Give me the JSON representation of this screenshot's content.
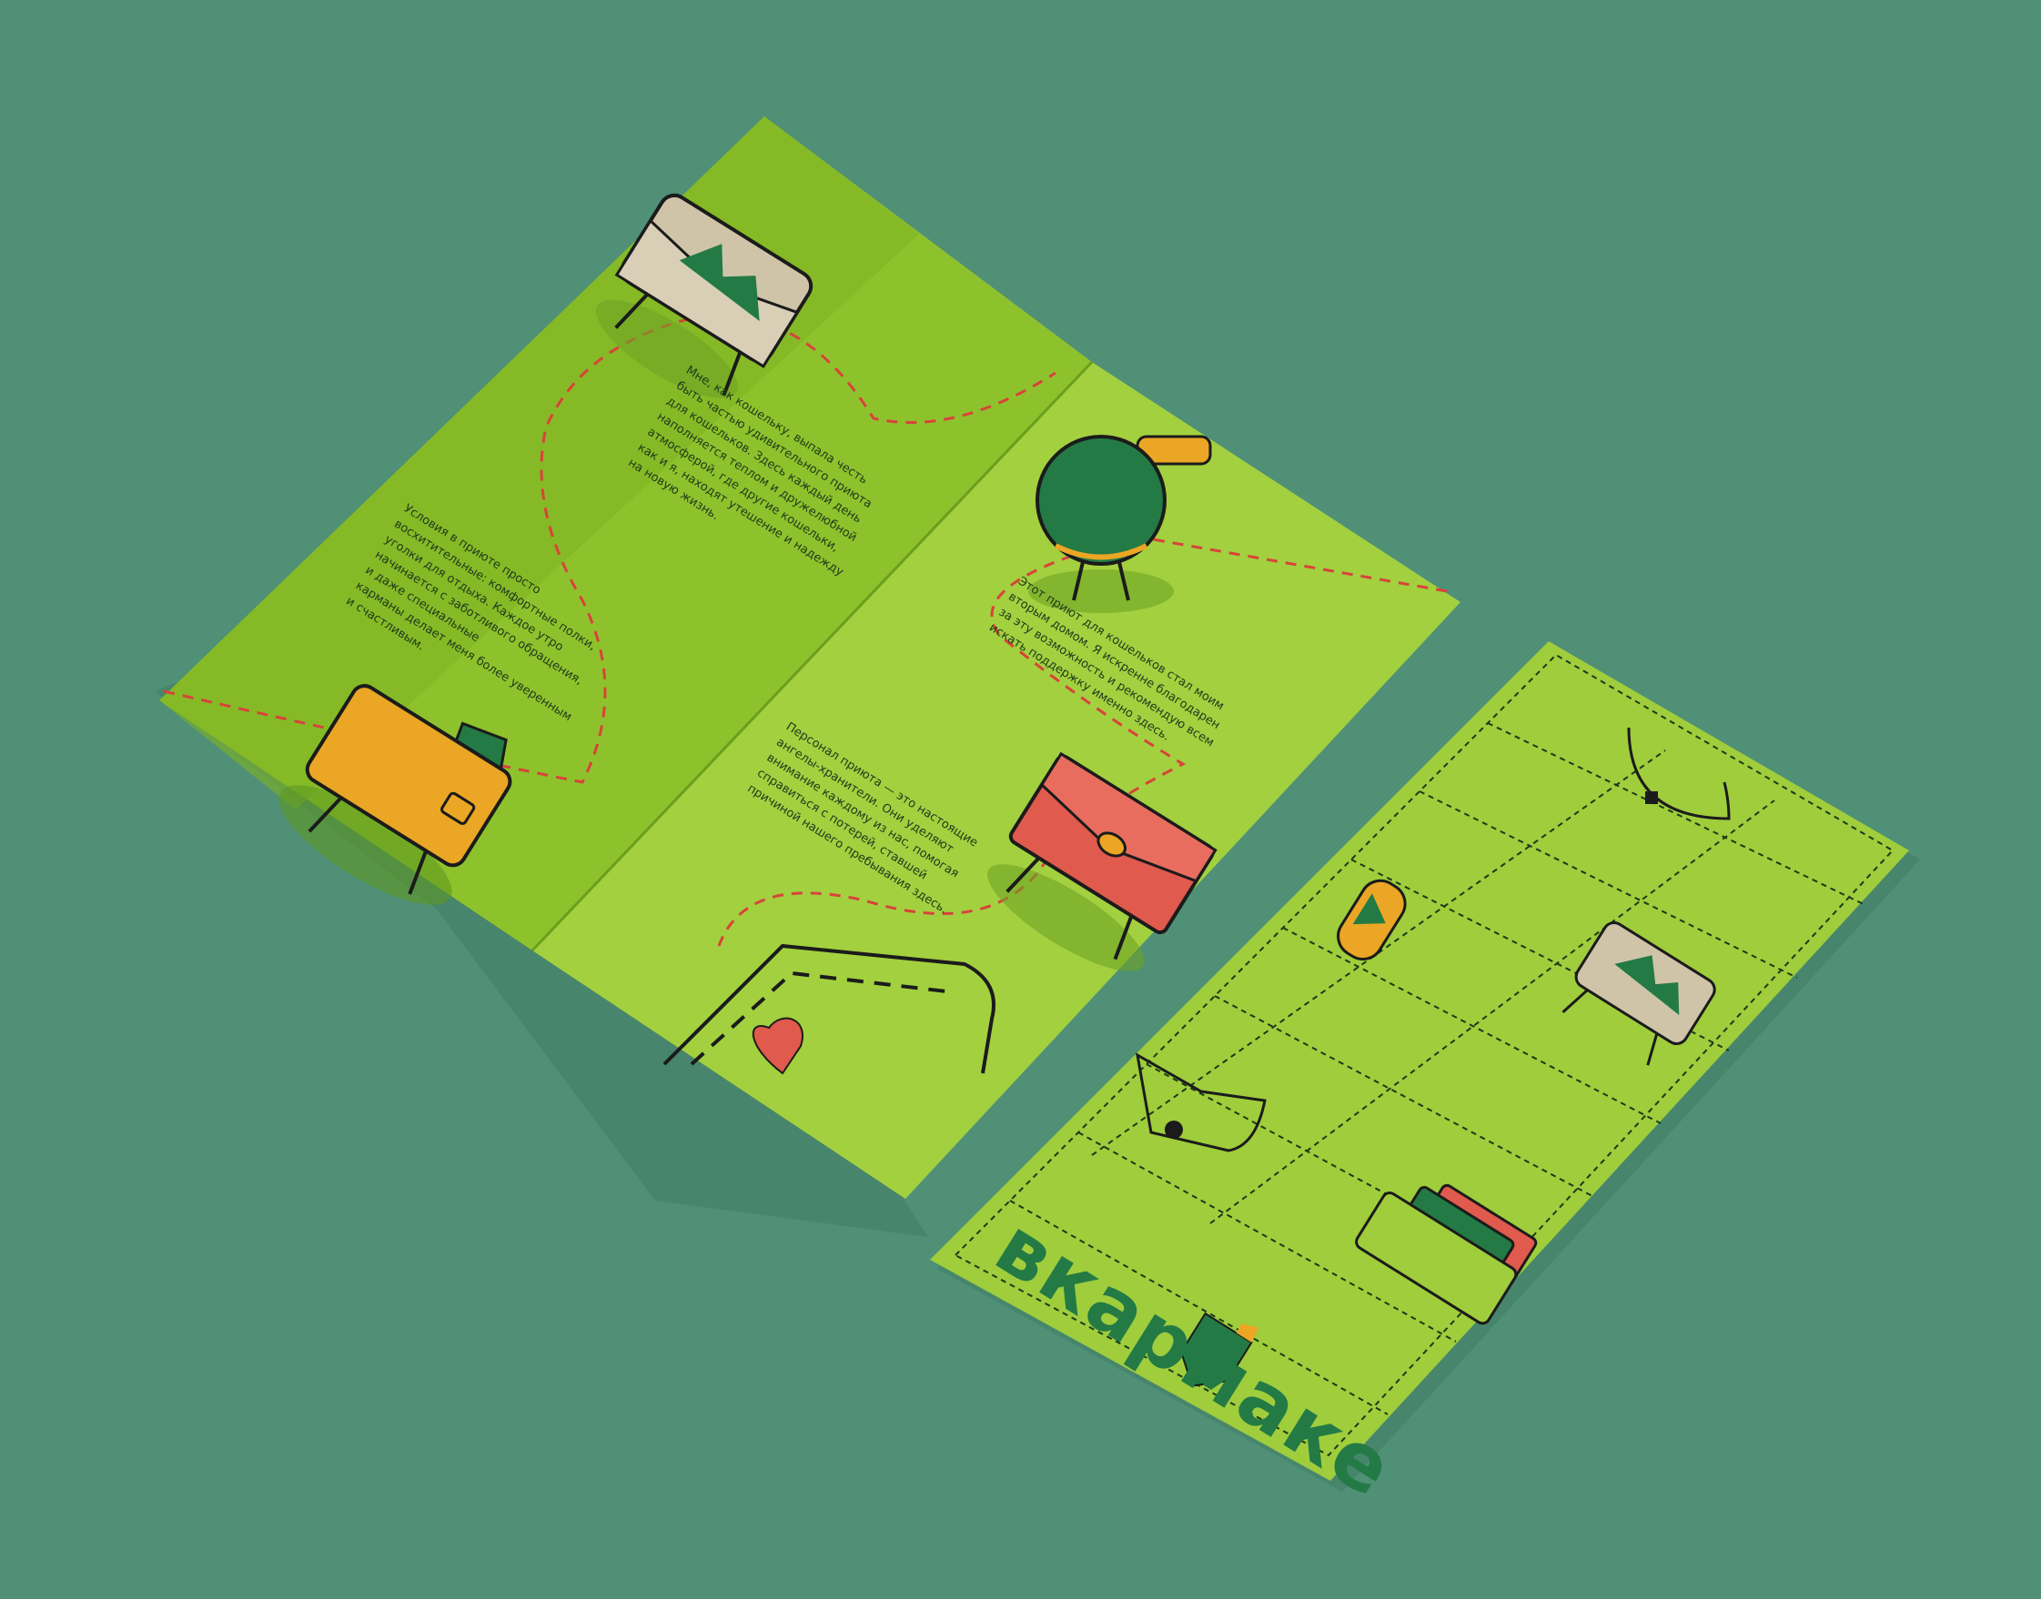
{
  "colors": {
    "background": "#4f9076",
    "paper": "#9fcd3c",
    "paper_shade": "#86b829",
    "dashed_route": "#d8433a",
    "brand_green": "#237a45",
    "wallet_yellow": "#eaa624",
    "wallet_red": "#e05a4d",
    "wallet_beige": "#cfc4a8"
  },
  "brochure": {
    "panels": [
      {
        "text": "Мне, как кошельку, выпала честь\nбыть частью удивительного приюта\nдля кошельков. Здесь каждый день\nнаполняется теплом и дружелюбной\nатмосферой, где другие кошельки,\nкак и я, находят утешение и надежду\nна новую жизнь."
      },
      {
        "text": "Условия в приюте просто\nвосхитительные: комфортные полки,\nуголки для отдыха. Каждое утро\nначинается с заботливого обращения,\nи даже специальные\nкарманы делает меня более уверенным\nи счастливым."
      },
      {
        "text": "Этот приют для кошельков стал моим\nвторым домом. Я искренне благодарен\nза эту возможность и рекомендую всем\nискать поддержку именно здесь."
      },
      {
        "text": "Персонал приюта — это настоящие\nангелы-хранители. Они уделяют\nвнимание каждому из нас, помогая\nсправиться с потерей, ставшей\nпричиной нашего пребывания здесь."
      }
    ],
    "icons": [
      "envelope-wallet-icon",
      "round-coin-purse-icon",
      "red-clutch-icon",
      "yellow-wallet-icon",
      "pocket-heart-icon"
    ]
  },
  "card": {
    "logo": "вкармаке",
    "icons": [
      "half-circle-purse-icon",
      "yellow-pouch-icon",
      "envelope-wallet-icon",
      "button-pocket-icon",
      "card-holder-icon",
      "pocket-logo-icon"
    ]
  }
}
